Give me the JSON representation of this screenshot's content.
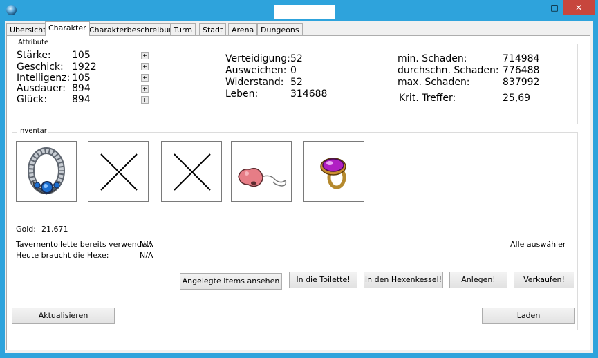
{
  "window": {
    "title": "",
    "controls": {
      "minimize": "–",
      "maximize": "□",
      "close": "✕"
    }
  },
  "tabs": [
    "Übersicht",
    "Charakter",
    "Charakterbeschreibung",
    "Turm",
    "Stadt",
    "Arena",
    "Dungeons"
  ],
  "active_tab": "Charakter",
  "attributes": {
    "title": "Attribute",
    "stats": [
      {
        "label": "Stärke:",
        "value": "105"
      },
      {
        "label": "Geschick:",
        "value": "1922"
      },
      {
        "label": "Intelligenz:",
        "value": "105"
      },
      {
        "label": "Ausdauer:",
        "value": "894"
      },
      {
        "label": "Glück:",
        "value": "894"
      }
    ],
    "plus_label": "+",
    "defense": [
      {
        "label": "Verteidigung:",
        "value": "52"
      },
      {
        "label": "Ausweichen:",
        "value": "0"
      },
      {
        "label": "Widerstand:",
        "value": "52"
      },
      {
        "label": "Leben:",
        "value": "314688"
      }
    ],
    "damage": [
      {
        "label": "min. Schaden:",
        "value": "714984"
      },
      {
        "label": "durchschn. Schaden:",
        "value": "776488"
      },
      {
        "label": "max. Schaden:",
        "value": "837992"
      },
      {
        "label": "Krit. Treffer:",
        "value": "25,69"
      }
    ]
  },
  "inventory": {
    "title": "Inventar",
    "slots": [
      "necklace-icon",
      "empty-slot-x-icon",
      "empty-slot-x-icon",
      "nose-glasses-icon",
      "purple-gem-ring-icon"
    ],
    "gold_label": "Gold:",
    "gold_value": "21.671",
    "toilet_label": "Tavernentoilette bereits verwendet:",
    "toilet_value": "N/A",
    "witch_label": "Heute braucht die Hexe:",
    "witch_value": "N/A",
    "select_all_label": "Alle auswählen",
    "buttons": {
      "view_equipped": "Angelegte Items ansehen",
      "toilet": "In die Toilette!",
      "cauldron": "In den Hexenkessel!",
      "equip": "Anlegen!",
      "sell": "Verkaufen!"
    }
  },
  "footer": {
    "refresh": "Aktualisieren",
    "load": "Laden"
  }
}
